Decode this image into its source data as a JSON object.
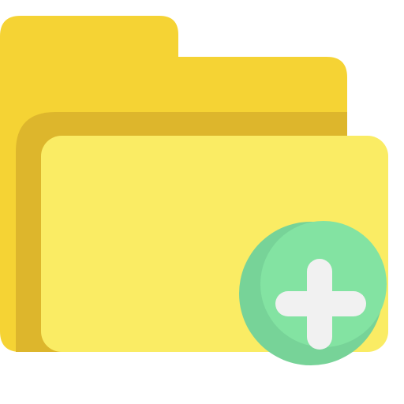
{
  "icon": {
    "name": "folder-add-icon",
    "colors": {
      "folder_back": "#F5D334",
      "folder_shadow": "#DDB62C",
      "folder_front": "#FAEC64",
      "badge_light": "#83E3A2",
      "badge_dark": "#77D398",
      "plus": "#F1F1F1"
    }
  }
}
